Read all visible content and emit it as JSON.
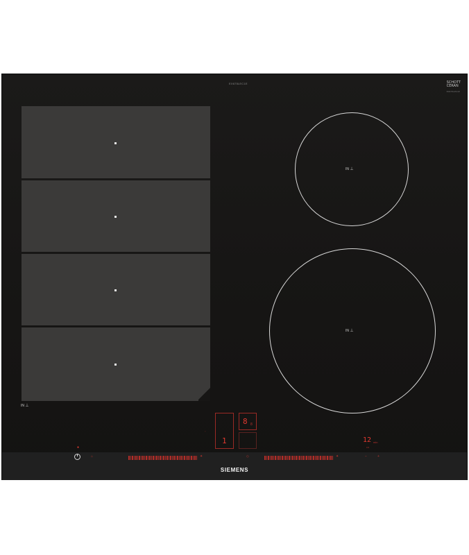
{
  "product": {
    "model_label": "EX675LEC1E",
    "brand_top": "SCHOTT",
    "brand_top_sub": "CERAN",
    "brand_top_model": "EX675LEC1E",
    "brand_bottom": "SIEMENS"
  },
  "zones": {
    "flex_label": "IN",
    "small_ring_label": "IN",
    "large_ring_label": "IN"
  },
  "controls": {
    "segment_display_main": "1",
    "segment_display_top": "8",
    "segment_display_top_suffix": "8",
    "timer_value": "12",
    "timer_unit": "min",
    "timer_sub": "0.5"
  },
  "colors": {
    "panel": "#171615",
    "flex_zone": "#3b3a39",
    "ring": "#d9d9d9",
    "display_red": "#e1392f"
  }
}
